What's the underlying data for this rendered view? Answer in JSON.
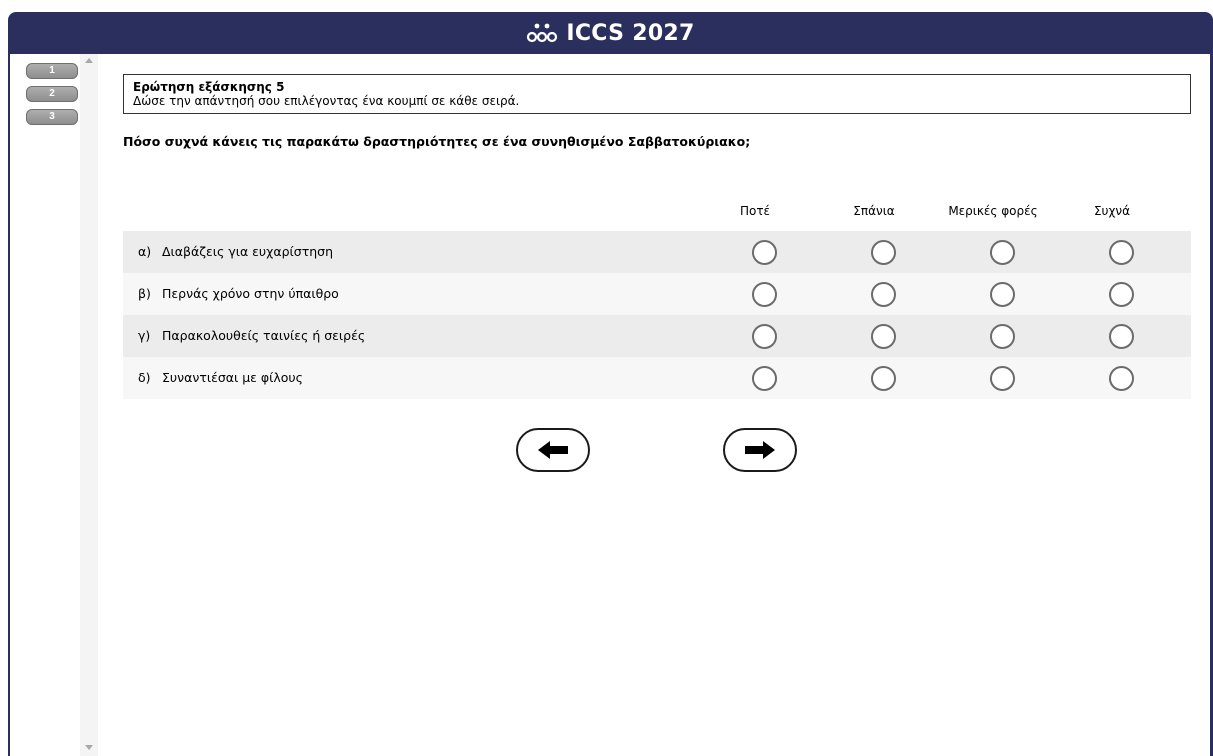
{
  "header": {
    "title": "ICCS 2027",
    "logo_icon": "people-group-icon"
  },
  "sidebar": {
    "items": [
      {
        "label": "1"
      },
      {
        "label": "2"
      },
      {
        "label": "3"
      }
    ]
  },
  "instructions": {
    "title": "Ερώτηση εξάσκησης 5",
    "text": "Δώσε την απάντησή σου επιλέγοντας ένα κουμπί σε κάθε σειρά."
  },
  "question": "Πόσο συχνά κάνεις τις παρακάτω δραστηριότητες σε ένα συνηθισμένο Σαββατοκύριακο;",
  "columns": [
    "Ποτέ",
    "Σπάνια",
    "Μερικές φορές",
    "Συχνά"
  ],
  "rows": [
    {
      "letter": "α)",
      "text": "Διαβάζεις για ευχαρίστηση"
    },
    {
      "letter": "β)",
      "text": "Περνάς χρόνο στην ύπαιθρο"
    },
    {
      "letter": "γ)",
      "text": "Παρακολουθείς ταινίες ή σειρές"
    },
    {
      "letter": "δ)",
      "text": "Συναντιέσαι με φίλους"
    }
  ],
  "navigation": {
    "back_icon": "arrow-left-icon",
    "next_icon": "arrow-right-icon"
  },
  "colors": {
    "frame": "#2b2f5e",
    "row_shade": "#ececec",
    "radio_border": "#6b6b6b"
  }
}
